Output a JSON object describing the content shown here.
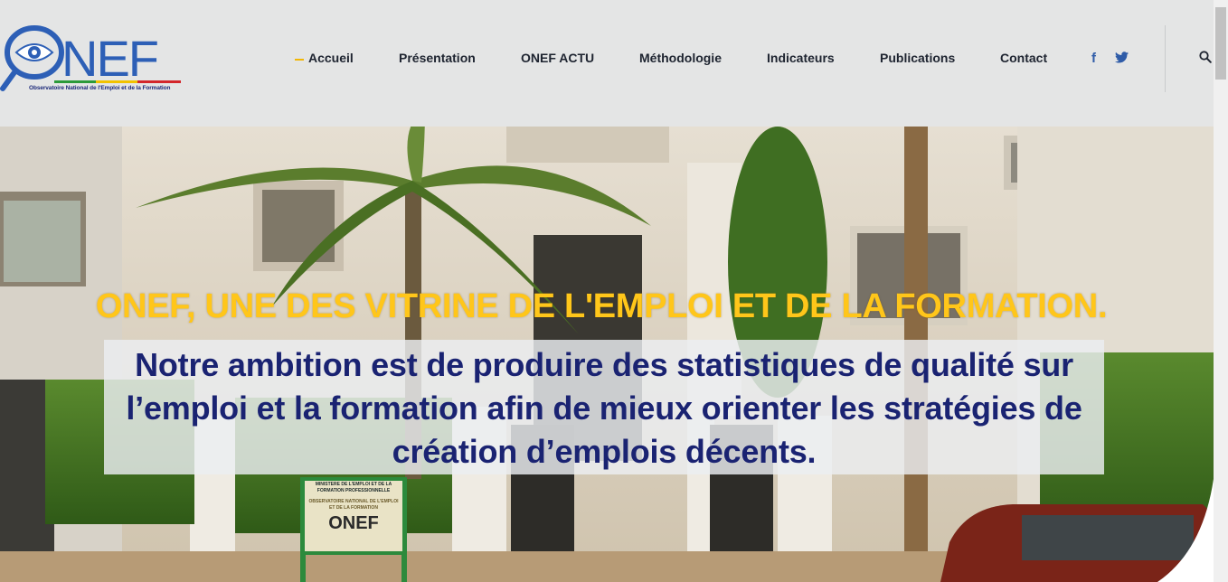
{
  "logo": {
    "name": "ONEF",
    "tagline": "Observatoire National de l'Emploi et de la Formation"
  },
  "nav": {
    "items": [
      {
        "label": "Accueil",
        "active": true
      },
      {
        "label": "Présentation"
      },
      {
        "label": "ONEF ACTU"
      },
      {
        "label": "Méthodologie"
      },
      {
        "label": "Indicateurs"
      },
      {
        "label": "Publications"
      },
      {
        "label": "Contact"
      }
    ],
    "social": {
      "facebook": "f",
      "twitter": "twitter-icon"
    },
    "search_icon": "search-icon"
  },
  "hero": {
    "title": "ONEF, UNE DES VITRINE DE L'EMPLOI ET DE LA FORMATION.",
    "subtitle": "Notre ambition est de produire des statistiques de qualité sur l’emploi et la formation afin de mieux orienter les stratégies de création d’emplois décents.",
    "sign": {
      "line1": "MINISTERE DE L'EMPLOI ET DE LA",
      "line2": "FORMATION PROFESSIONNELLE",
      "line3": "OBSERVATOIRE NATIONAL DE L'EMPLOI",
      "line4": "ET DE LA FORMATION",
      "name": "ONEF"
    }
  },
  "colors": {
    "header_bg": "#e4e5e5",
    "accent_yellow": "#ffc61a",
    "brand_blue": "#1a2372",
    "logo_blue": "#2d5fb6"
  }
}
